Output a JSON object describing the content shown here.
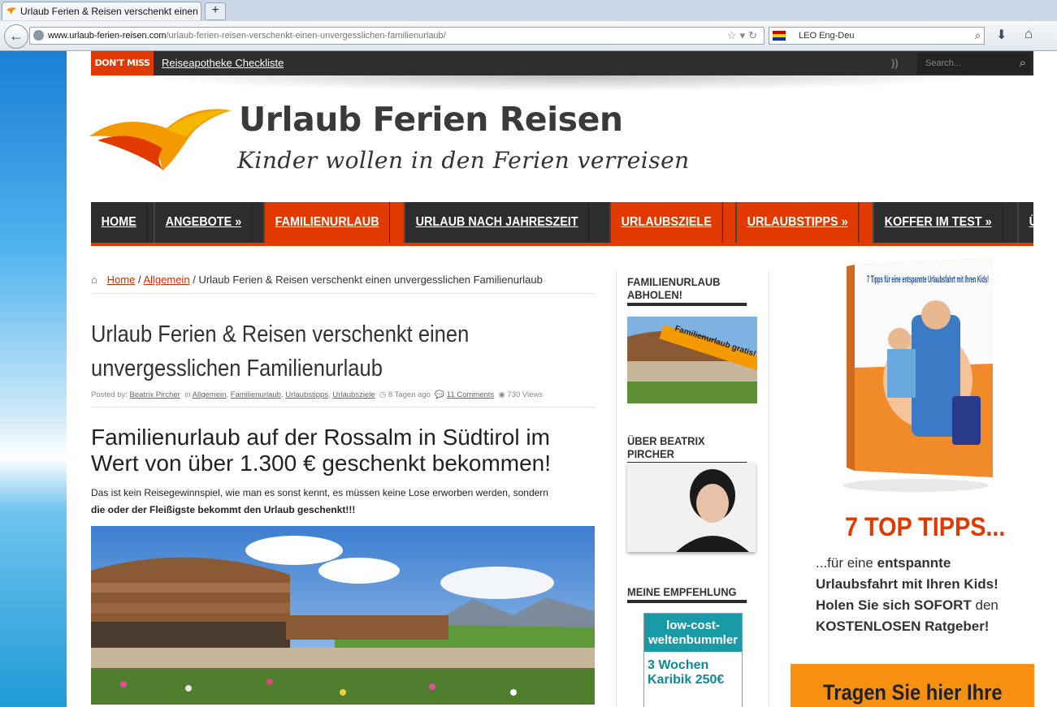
{
  "browser": {
    "tab_title": "Urlaub Ferien & Reisen verschenkt einen unv...",
    "new_tab": "+",
    "url_domain": "www.urlaub-ferien-reisen.com",
    "url_path": "/urlaub-ferien-reisen-verschenkt-einen-unvergesslichen-familienurlaub/",
    "search_engine": "LEO Eng-Deu"
  },
  "topbar": {
    "dont_miss": "DON'T MISS",
    "ticker": "Reiseapotheke Checkliste",
    "search_placeholder": "Search..."
  },
  "brand": {
    "title": "Urlaub Ferien Reisen",
    "tagline": "Kinder wollen in den Ferien verreisen",
    "accent": "#e03a00"
  },
  "nav": {
    "items": [
      {
        "label": "HOME",
        "active": false
      },
      {
        "label": "ANGEBOTE »",
        "active": false
      },
      {
        "label": "FAMILIENURLAUB",
        "active": true
      },
      {
        "label": "URLAUB NACH JAHRESZEIT",
        "active": false
      },
      {
        "label": "URLAUBSZIELE",
        "active": true
      },
      {
        "label": "URLAUBSTIPPS »",
        "active": true
      },
      {
        "label": "KOFFER IM TEST »",
        "active": false
      },
      {
        "label": "ÜBER BEATRIX PIRCHER",
        "active": false
      }
    ]
  },
  "breadcrumb": {
    "home": "Home",
    "sep": "/",
    "category": "Allgemein",
    "current": "Urlaub Ferien & Reisen verschenkt einen unvergesslichen Familienurlaub"
  },
  "post": {
    "title": "Urlaub Ferien & Reisen verschenkt einen unvergesslichen Familienurlaub",
    "meta": {
      "posted_by": "Posted by:",
      "author": "Beatrix Pircher",
      "in": "in",
      "categories": [
        "Allgemein",
        "Familienurlaub",
        "Urlaubstipps",
        "Urlaubsziele"
      ],
      "time": "8 Tagen ago",
      "comments": "11 Comments",
      "views": "730 Views"
    },
    "heading": "Familienurlaub auf der Rossalm in Südtirol im Wert von über 1.300 € geschenkt bekommen!",
    "intro_plain": "Das ist kein Reisegewinnspiel, wie man es sonst kennt, es müssen keine Lose erworben werden, sondern",
    "intro_bold": "die oder der Fleißigste bekommt den Urlaub geschenkt!!!"
  },
  "sidebar": {
    "widget1_title": "FAMILIENURLAUB ABHOLEN!",
    "widget1_banner": "Familienurlaub gratis!",
    "widget2_title": "ÜBER BEATRIX PIRCHER",
    "widget3_title": "MEINE EMPFEHLUNG",
    "ad_top": "low-cost-weltenbummler",
    "ad_mid": "3 Wochen Karibik 250€"
  },
  "right": {
    "book_title": "7 Tipps für eine entspannte Urlaubsfahrt mit Ihren Kids!",
    "headline": "7 TOP TIPPS...",
    "line1_plain": "...für eine ",
    "line1_bold": "entspannte Urlaubsfahrt mit Ihren Kids!",
    "line2_bold": "Holen Sie sich SOFORT",
    "line2_plain": " den ",
    "line3_bold": "KOSTENLOSEN Ratgeber!",
    "cta": "Tragen Sie hier Ihre"
  }
}
